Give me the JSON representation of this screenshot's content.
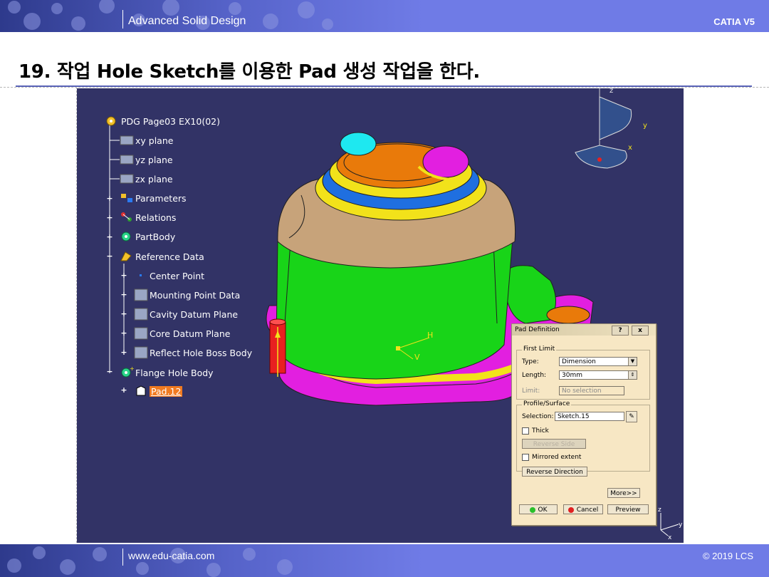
{
  "header": {
    "title": "Advanced Solid Design",
    "app": "CATIA V5"
  },
  "slide": {
    "title": "19. 작업 Hole Sketch를 이용한 Pad 생성 작업을 한다."
  },
  "tree": {
    "root": "PDG Page03 EX10(02)",
    "items": [
      "xy plane",
      "yz plane",
      "zx plane",
      "Parameters",
      "Relations",
      "PartBody",
      "Reference Data",
      "Center Point",
      "Mounting Point Data",
      "Cavity Datum Plane",
      "Core Datum Plane",
      "Reflect Hole Boss Body",
      "Flange Hole Body",
      "Pad.12"
    ]
  },
  "viewport": {
    "handle_h": "H",
    "handle_v": "V",
    "axis_z": "z",
    "axis_y": "y",
    "axis_x": "x",
    "mini_z": "z",
    "mini_y": "y",
    "mini_x": "x"
  },
  "dialog": {
    "title": "Pad Definition",
    "help": "?",
    "close": "x",
    "first_limit": "First Limit",
    "type_label": "Type:",
    "type_value": "Dimension",
    "length_label": "Length:",
    "length_value": "30mm",
    "limit_label": "Limit:",
    "limit_value": "No selection",
    "profile_group": "Profile/Surface",
    "selection_label": "Selection:",
    "selection_value": "Sketch.15",
    "thick_label": "Thick",
    "reverse_side": "Reverse Side",
    "mirrored_label": "Mirrored extent",
    "reverse_direction": "Reverse Direction",
    "more": "More>>",
    "ok": "OK",
    "cancel": "Cancel",
    "preview": "Preview"
  },
  "footer": {
    "url": "www.edu-catia.com",
    "copyright": "© 2019 LCS"
  },
  "colors": {
    "header": "#5663c9",
    "viewport_bg": "#323366",
    "dialog_bg": "#f7e7c4"
  }
}
